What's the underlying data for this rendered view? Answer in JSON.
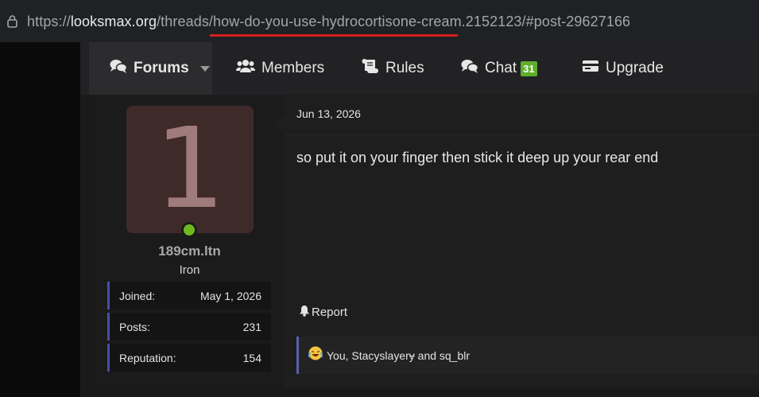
{
  "browser": {
    "url_scheme": "https://",
    "url_host": "looksmax.org",
    "url_path1": "/threads/",
    "url_slug": "how-do-you-use-hydrocortisone-cream",
    "url_rest": ".2152123/#post-29627166"
  },
  "nav": {
    "tabs": [
      {
        "label": "Forums",
        "icon": "comments-icon"
      },
      {
        "label": "Members",
        "icon": "users-icon"
      },
      {
        "label": "Rules",
        "icon": "scroll-icon"
      },
      {
        "label": "Chat",
        "icon": "chat-icon",
        "badge": "31"
      },
      {
        "label": "Upgrade",
        "icon": "card-icon"
      }
    ]
  },
  "user": {
    "avatar_letter": "1",
    "name": "189cm.ltn",
    "title": "Iron",
    "stats": [
      {
        "label": "Joined:",
        "value": "May 1, 2026"
      },
      {
        "label": "Posts:",
        "value": "231"
      },
      {
        "label": "Reputation:",
        "value": "154"
      }
    ]
  },
  "post": {
    "date": "Jun 13, 2026",
    "message": "so put it on your finger then stick it deep up your rear end",
    "report_label": "Report",
    "reactions": "You, Stacyslayerɏ and sq_blr"
  },
  "colors": {
    "accent": "#4a4fa8",
    "online": "#6fb71e",
    "badge": "#5fae2b",
    "underline": "#d61f1f"
  }
}
